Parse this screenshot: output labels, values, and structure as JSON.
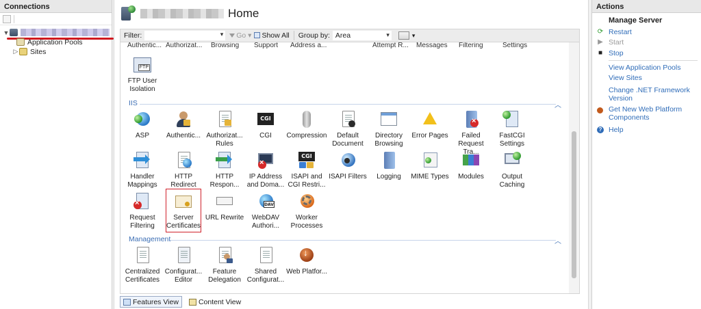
{
  "connections": {
    "title": "Connections",
    "tree": {
      "app_pools": "Application Pools",
      "sites": "Sites"
    }
  },
  "header": {
    "title": "Home"
  },
  "filter_bar": {
    "filter_label": "Filter:",
    "go_label": "Go",
    "show_all_label": "Show All",
    "group_by_label": "Group by:",
    "group_by_value": "Area"
  },
  "cut_row": [
    "Authentic...",
    "Authorizat...",
    "Browsing",
    "Support",
    "Address a...",
    "Attempt R...",
    "Messages",
    "Filtering",
    "Settings"
  ],
  "ftp": {
    "items": [
      {
        "label": "FTP User Isolation",
        "icon": "ftp-user-isolation-icon"
      }
    ]
  },
  "groups": {
    "iis": "IIS",
    "management": "Management"
  },
  "iis_items": [
    {
      "label": "ASP",
      "icon": "asp-icon"
    },
    {
      "label": "Authentic...",
      "icon": "authentication-icon"
    },
    {
      "label": "Authorizat... Rules",
      "icon": "authorization-rules-icon"
    },
    {
      "label": "CGI",
      "icon": "cgi-icon"
    },
    {
      "label": "Compression",
      "icon": "compression-icon"
    },
    {
      "label": "Default Document",
      "icon": "default-document-icon"
    },
    {
      "label": "Directory Browsing",
      "icon": "directory-browsing-icon"
    },
    {
      "label": "Error Pages",
      "icon": "error-pages-icon"
    },
    {
      "label": "Failed Request Tra...",
      "icon": "failed-request-tracing-icon"
    },
    {
      "label": "FastCGI Settings",
      "icon": "fastcgi-settings-icon"
    },
    {
      "label": "Handler Mappings",
      "icon": "handler-mappings-icon"
    },
    {
      "label": "HTTP Redirect",
      "icon": "http-redirect-icon"
    },
    {
      "label": "HTTP Respon...",
      "icon": "http-response-headers-icon"
    },
    {
      "label": "IP Address and Doma...",
      "icon": "ip-address-domain-icon"
    },
    {
      "label": "ISAPI and CGI Restri...",
      "icon": "isapi-cgi-restrictions-icon"
    },
    {
      "label": "ISAPI Filters",
      "icon": "isapi-filters-icon"
    },
    {
      "label": "Logging",
      "icon": "logging-icon"
    },
    {
      "label": "MIME Types",
      "icon": "mime-types-icon"
    },
    {
      "label": "Modules",
      "icon": "modules-icon"
    },
    {
      "label": "Output Caching",
      "icon": "output-caching-icon"
    },
    {
      "label": "Request Filtering",
      "icon": "request-filtering-icon"
    },
    {
      "label": "Server Certificates",
      "icon": "server-certificates-icon"
    },
    {
      "label": "URL Rewrite",
      "icon": "url-rewrite-icon"
    },
    {
      "label": "WebDAV Authori...",
      "icon": "webdav-authoring-icon"
    },
    {
      "label": "Worker Processes",
      "icon": "worker-processes-icon"
    }
  ],
  "management_items": [
    {
      "label": "Centralized Certificates",
      "icon": "centralized-certificates-icon"
    },
    {
      "label": "Configurat... Editor",
      "icon": "configuration-editor-icon"
    },
    {
      "label": "Feature Delegation",
      "icon": "feature-delegation-icon"
    },
    {
      "label": "Shared Configurat...",
      "icon": "shared-configuration-icon"
    },
    {
      "label": "Web Platfor...",
      "icon": "web-platform-icon"
    }
  ],
  "bottom_tabs": {
    "features_view": "Features View",
    "content_view": "Content View"
  },
  "actions": {
    "title": "Actions",
    "manage_server": "Manage Server",
    "restart": "Restart",
    "start": "Start",
    "stop": "Stop",
    "view_app_pools": "View Application Pools",
    "view_sites": "View Sites",
    "change_net": "Change .NET Framework Version",
    "get_new_platform": "Get New Web Platform Components",
    "help": "Help"
  },
  "colors": {
    "link": "#2f6cb8",
    "group_header": "#3c6eb4",
    "highlight": "#d0202a"
  }
}
